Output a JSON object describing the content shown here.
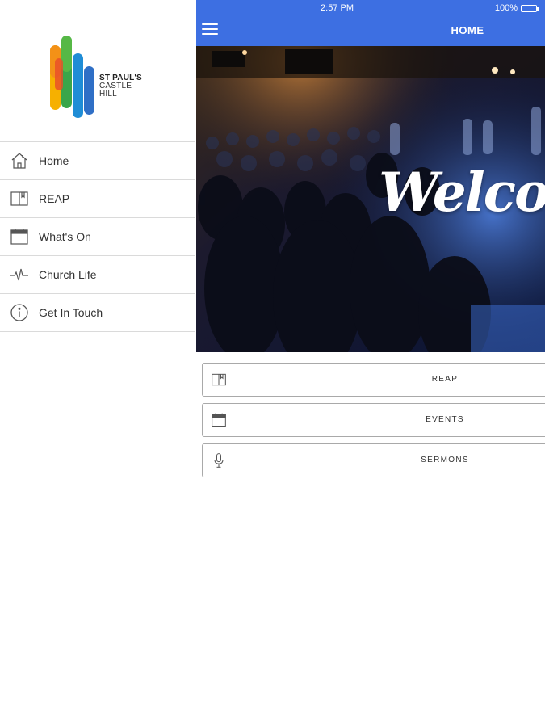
{
  "sidebar": {
    "logo": {
      "line1": "ST PAUL'S",
      "line2": "CASTLE",
      "line3": "HILL"
    },
    "items": [
      {
        "label": "Home",
        "icon": "home-icon"
      },
      {
        "label": "REAP",
        "icon": "book-icon"
      },
      {
        "label": "What's On",
        "icon": "calendar-icon"
      },
      {
        "label": "Church Life",
        "icon": "heartbeat-icon"
      },
      {
        "label": "Get In Touch",
        "icon": "info-icon"
      }
    ]
  },
  "status": {
    "time": "2:57 PM",
    "battery": "100%",
    "battery_level": 1.0
  },
  "header": {
    "title": "HOME"
  },
  "hero": {
    "text": "Welcome"
  },
  "actions": [
    {
      "label": "REAP",
      "icon": "book-icon"
    },
    {
      "label": "EVENTS",
      "icon": "calendar-icon"
    },
    {
      "label": "SERMONS",
      "icon": "microphone-icon"
    }
  ],
  "colors": {
    "accent": "#3d6fe2",
    "battery": "#4cd964"
  }
}
